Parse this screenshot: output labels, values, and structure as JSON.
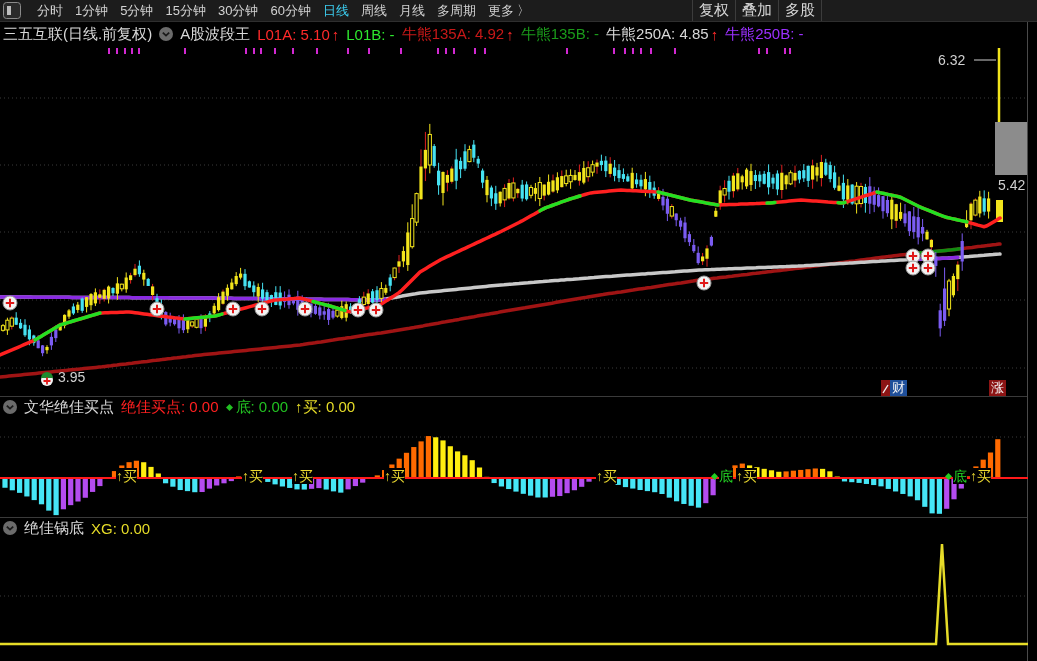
{
  "toolbar": {
    "tabs": [
      {
        "label": "分时",
        "selected": false
      },
      {
        "label": "1分钟",
        "selected": false
      },
      {
        "label": "5分钟",
        "selected": false
      },
      {
        "label": "15分钟",
        "selected": false
      },
      {
        "label": "30分钟",
        "selected": false
      },
      {
        "label": "60分钟",
        "selected": false
      },
      {
        "label": "日线",
        "selected": true
      },
      {
        "label": "周线",
        "selected": false
      },
      {
        "label": "月线",
        "selected": false
      },
      {
        "label": "多周期",
        "selected": false
      },
      {
        "label": "更多 〉",
        "selected": false
      }
    ],
    "buttons": [
      "复权",
      "叠加",
      "多股"
    ]
  },
  "main_chart": {
    "security": "三五互联(日线.前复权)",
    "indicator": "A股波段王",
    "legend": [
      {
        "label": "L01A: 5.10",
        "color": "#ff2a2a",
        "arrow": "↑"
      },
      {
        "label": "L01B: -",
        "color": "#2ee82e"
      },
      {
        "label": "牛熊135A: 4.92",
        "color": "#c81818",
        "arrow": "↑"
      },
      {
        "label": "牛熊135B: -",
        "color": "#1a9a1a"
      },
      {
        "label": "牛熊250A: 4.85",
        "color": "#d8d8d8",
        "arrow": "↑"
      },
      {
        "label": "牛熊250B: -",
        "color": "#9b30ff"
      }
    ],
    "price_labels": [
      "6.32",
      "5.42",
      "3.95"
    ],
    "tags": [
      {
        "label": "财",
        "color": "#1f4f9a"
      },
      {
        "label": "涨",
        "color": "#8c1414"
      }
    ]
  },
  "signal_panel": {
    "title": "文华绝佳买点",
    "legend": [
      {
        "kind": "text",
        "label": "绝佳买点: 0.00",
        "color": "#ff2020"
      },
      {
        "kind": "diamond",
        "label": "底: 0.00",
        "color": "#22c022"
      },
      {
        "kind": "text",
        "label": "↑买: 0.00",
        "color": "#e6dc28"
      }
    ],
    "signals": [
      {
        "kind": "buy",
        "label": "↑买"
      },
      {
        "kind": "buy",
        "label": "↑买"
      },
      {
        "kind": "buy",
        "label": "↑买"
      },
      {
        "kind": "buy",
        "label": "↑买"
      },
      {
        "kind": "buy",
        "label": "↑买"
      },
      {
        "kind": "bottom",
        "label": "底"
      },
      {
        "kind": "buy",
        "label": "↑买"
      },
      {
        "kind": "bottom",
        "label": "底"
      },
      {
        "kind": "buy",
        "label": "↑买"
      }
    ]
  },
  "bottom_panel": {
    "title": "绝佳锅底",
    "legend": [
      {
        "label": "XG: 0.00",
        "color": "#e6dc28"
      }
    ]
  }
}
